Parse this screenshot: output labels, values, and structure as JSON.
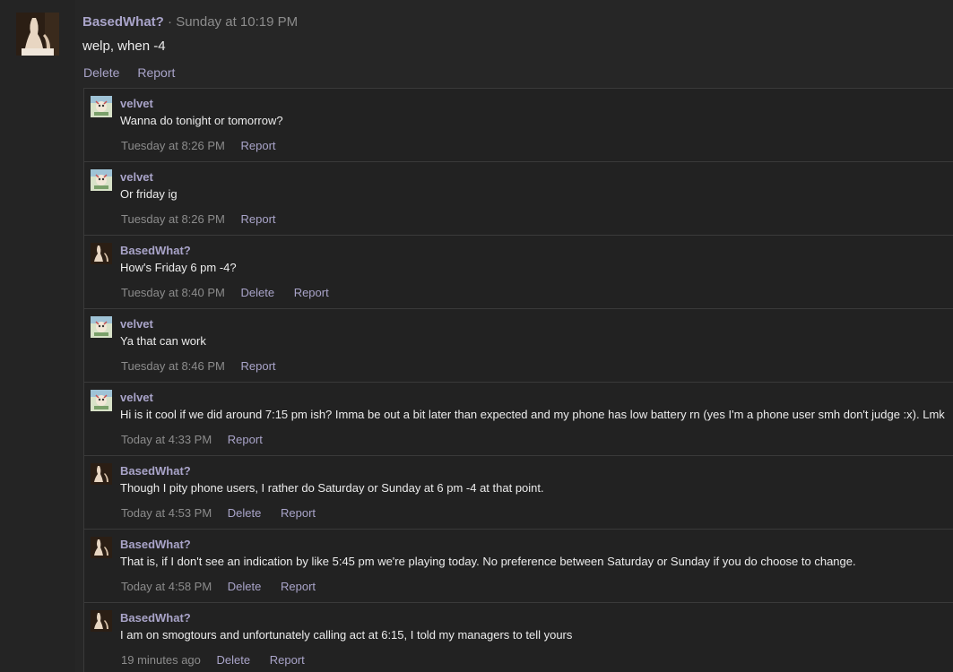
{
  "post": {
    "author": "BasedWhat?",
    "separator": "·",
    "time": "Sunday at 10:19 PM",
    "body": "welp, when -4",
    "actions": {
      "delete": "Delete",
      "report": "Report"
    }
  },
  "replies": [
    {
      "author": "velvet",
      "avatar": "velvet-avatar",
      "text": "Wanna do tonight or tomorrow?",
      "time": "Tuesday at 8:26 PM",
      "delete": "",
      "report": "Report"
    },
    {
      "author": "velvet",
      "avatar": "velvet-avatar",
      "text": "Or friday ig",
      "time": "Tuesday at 8:26 PM",
      "delete": "",
      "report": "Report"
    },
    {
      "author": "BasedWhat?",
      "avatar": "basedwhat-avatar",
      "text": "How's Friday 6 pm -4?",
      "time": "Tuesday at 8:40 PM",
      "delete": "Delete",
      "report": "Report"
    },
    {
      "author": "velvet",
      "avatar": "velvet-avatar",
      "text": "Ya that can work",
      "time": "Tuesday at 8:46 PM",
      "delete": "",
      "report": "Report"
    },
    {
      "author": "velvet",
      "avatar": "velvet-avatar",
      "text": "Hi is it cool if we did around 7:15 pm ish? Imma be out a bit later than expected and my phone has low battery rn (yes I'm a phone user smh don't judge :x). Lmk",
      "time": "Today at 4:33 PM",
      "delete": "",
      "report": "Report"
    },
    {
      "author": "BasedWhat?",
      "avatar": "basedwhat-avatar",
      "text": "Though I pity phone users, I rather do Saturday or Sunday at 6 pm -4 at that point.",
      "time": "Today at 4:53 PM",
      "delete": "Delete",
      "report": "Report"
    },
    {
      "author": "BasedWhat?",
      "avatar": "basedwhat-avatar",
      "text": "That is, if I don't see an indication by like 5:45 pm we're playing today. No preference between Saturday or Sunday if you do choose to change.",
      "time": "Today at 4:58 PM",
      "delete": "Delete",
      "report": "Report"
    },
    {
      "author": "BasedWhat?",
      "avatar": "basedwhat-avatar",
      "text": "I am on smogtours and unfortunately calling act at 6:15, I told my managers to tell yours",
      "time": "19 minutes ago",
      "delete": "Delete",
      "report": "Report"
    }
  ],
  "colors": {
    "background": "#1b1b1b",
    "panel": "#262626",
    "link": "#a9a4c9",
    "muted": "#8c8c8c",
    "text": "#ececec"
  }
}
